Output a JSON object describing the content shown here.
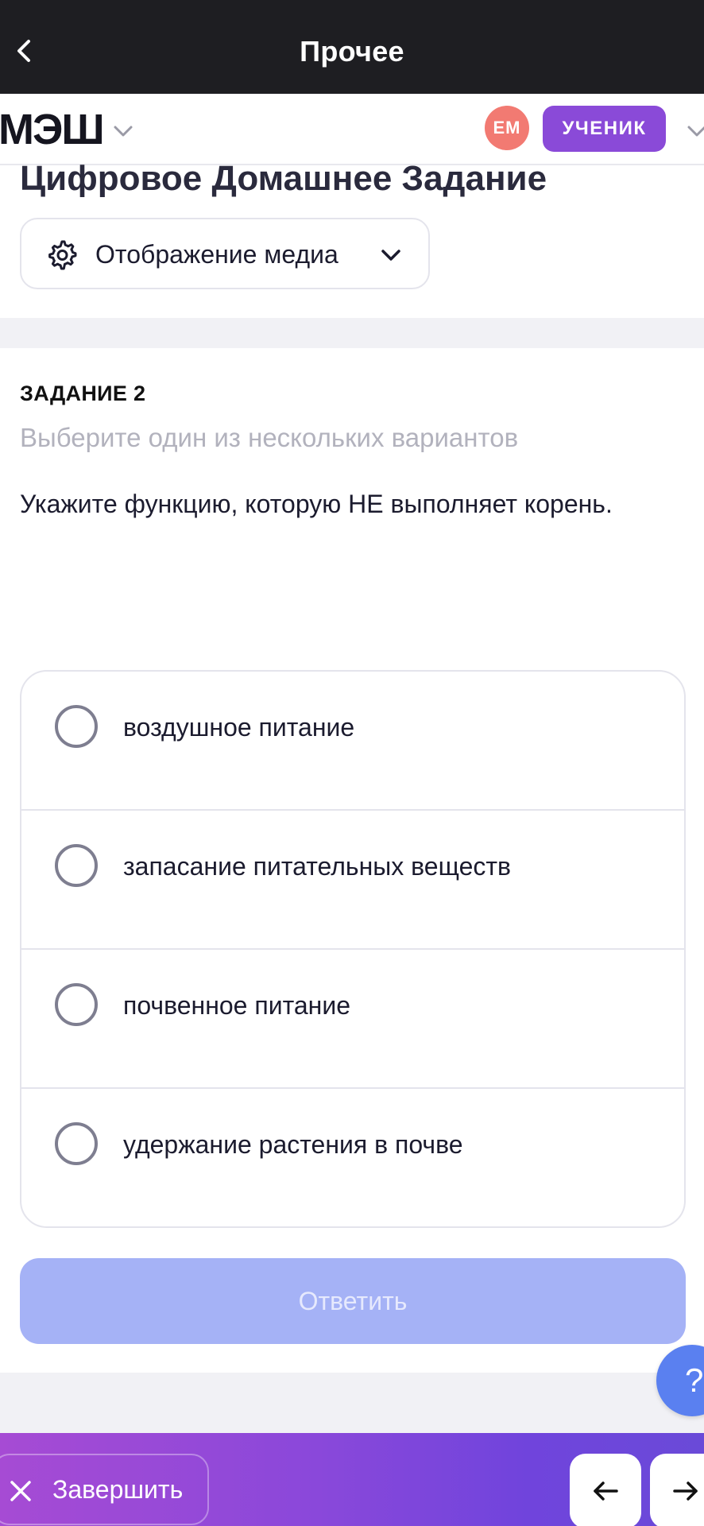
{
  "topbar": {
    "title": "Прочее"
  },
  "header": {
    "logo": "МЭШ",
    "avatar_initials": "ЕМ",
    "role": "УЧЕНИК"
  },
  "page": {
    "title": "Цифровое Домашнее Задание",
    "media_select_label": "Отображение медиа"
  },
  "task": {
    "number_label": "ЗАДАНИЕ 2",
    "hint": "Выберите один из нескольких вариантов",
    "question": "Укажите функцию, которую НЕ выполняет корень.",
    "options": [
      "воздушное питание",
      "запасание питательных веществ",
      "почвенное питание",
      "удержание растения в почве"
    ],
    "answer_button": "Ответить"
  },
  "help_button": "?",
  "bottombar": {
    "finish_label": "Завершить"
  },
  "colors": {
    "accent": "#8a4ad8",
    "answer_disabled": "#a5b2f6",
    "avatar": "#f27a72",
    "help": "#5a80f0"
  }
}
